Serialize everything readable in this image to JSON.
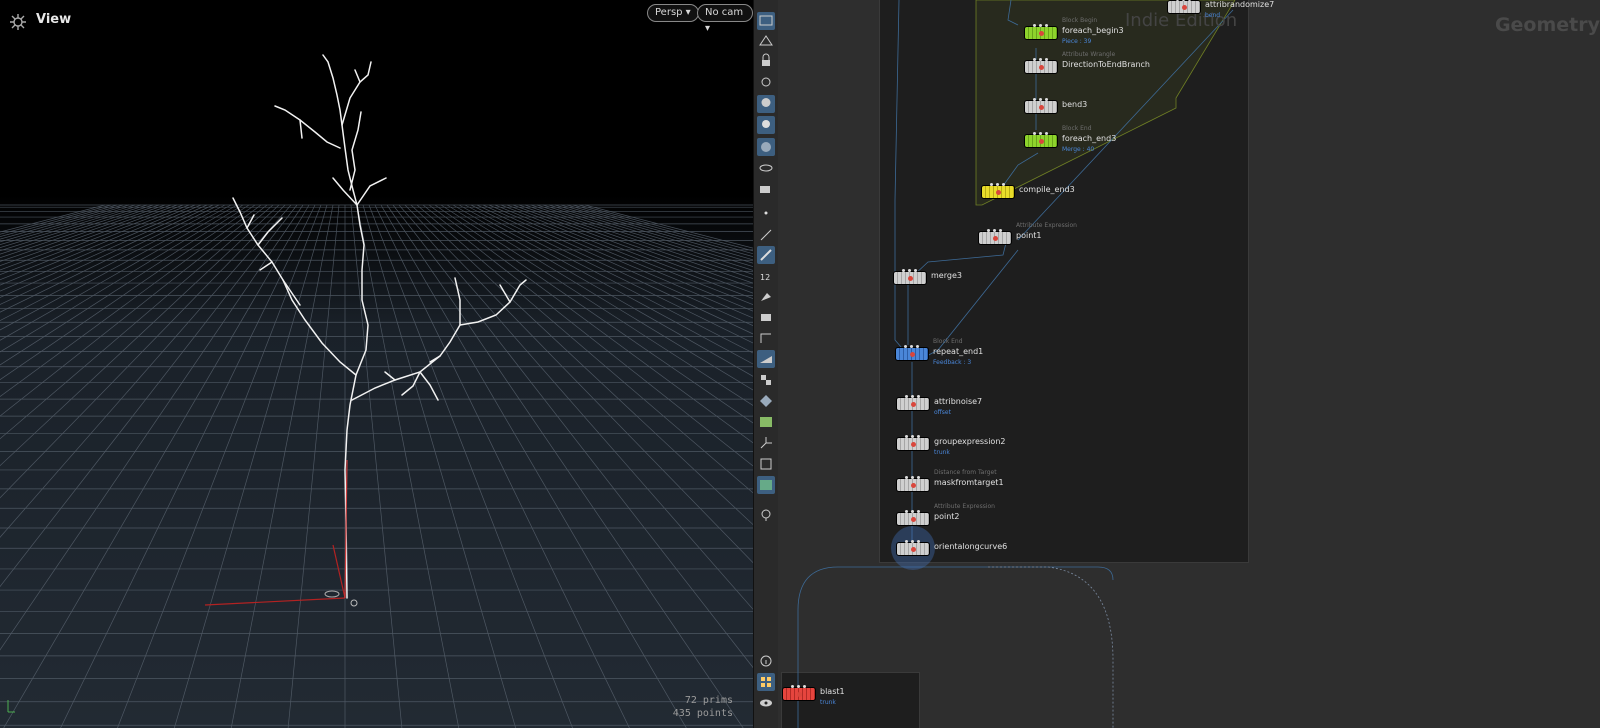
{
  "viewport": {
    "title": "View",
    "persp_label": "Persp ▾",
    "cam_label": "No cam ▾",
    "stats": [
      "72  prims",
      "435 points"
    ]
  },
  "toolbar": {
    "icons": [
      "select-viewport-icon",
      "display-options-icon",
      "lock-icon",
      "snap-icon",
      "light-icon",
      "headlight-icon",
      "shaded-icon",
      "visibility-icon",
      "camera-icon",
      "point-icon",
      "edge-icon",
      "pen-icon",
      "number-icon",
      "brush-icon",
      "stack-icon",
      "bracket-icon",
      "ramp-icon",
      "checker-icon",
      "diamond-icon",
      "image-icon",
      "axes-icon",
      "square-icon",
      "photo-icon",
      "pin-icon",
      "info-icon",
      "grid-icon",
      "eye-icon"
    ],
    "active": [
      "select-viewport-icon",
      "light-icon",
      "headlight-icon",
      "shaded-icon",
      "pen-icon",
      "ramp-icon",
      "photo-icon",
      "grid-icon"
    ]
  },
  "network": {
    "watermark_edition": "Indie Edition",
    "watermark_context": "Geometry",
    "nodes": [
      {
        "id": "attribrandomize7",
        "label": "attribrandomize7",
        "color": "gray",
        "sub": "",
        "note": "bend"
      },
      {
        "id": "foreach_begin3",
        "label": "foreach_begin3",
        "color": "green",
        "sub": "Block Begin",
        "note": "Piece : 39"
      },
      {
        "id": "DirectionToEndBranch",
        "label": "DirectionToEndBranch",
        "color": "gray",
        "sub": "Attribute Wrangle",
        "note": ""
      },
      {
        "id": "bend3",
        "label": "bend3",
        "color": "gray",
        "sub": "",
        "note": ""
      },
      {
        "id": "foreach_end3",
        "label": "foreach_end3",
        "color": "green",
        "sub": "Block End",
        "note": "Merge : 40"
      },
      {
        "id": "compile_end3",
        "label": "compile_end3",
        "color": "yellow",
        "sub": "",
        "note": ""
      },
      {
        "id": "point1",
        "label": "point1",
        "color": "gray",
        "sub": "Attribute Expression",
        "note": ""
      },
      {
        "id": "merge3",
        "label": "merge3",
        "color": "gray",
        "sub": "",
        "note": ""
      },
      {
        "id": "repeat_end1",
        "label": "repeat_end1",
        "color": "blue",
        "sub": "Block End",
        "note": "Feedback : 3"
      },
      {
        "id": "attribnoise7",
        "label": "attribnoise7",
        "color": "gray",
        "sub": "",
        "note": "offset"
      },
      {
        "id": "groupexpression2",
        "label": "groupexpression2",
        "color": "gray",
        "sub": "",
        "note": "trunk"
      },
      {
        "id": "maskfromtarget1",
        "label": "maskfromtarget1",
        "color": "gray",
        "sub": "Distance from Target",
        "note": ""
      },
      {
        "id": "point2",
        "label": "point2",
        "color": "gray",
        "sub": "Attribute Expression",
        "note": ""
      },
      {
        "id": "orientalongcurve6",
        "label": "orientalongcurve6",
        "color": "gray",
        "sub": "",
        "note": ""
      },
      {
        "id": "blast1",
        "label": "blast1",
        "color": "red",
        "sub": "",
        "note": "trunk"
      }
    ]
  }
}
